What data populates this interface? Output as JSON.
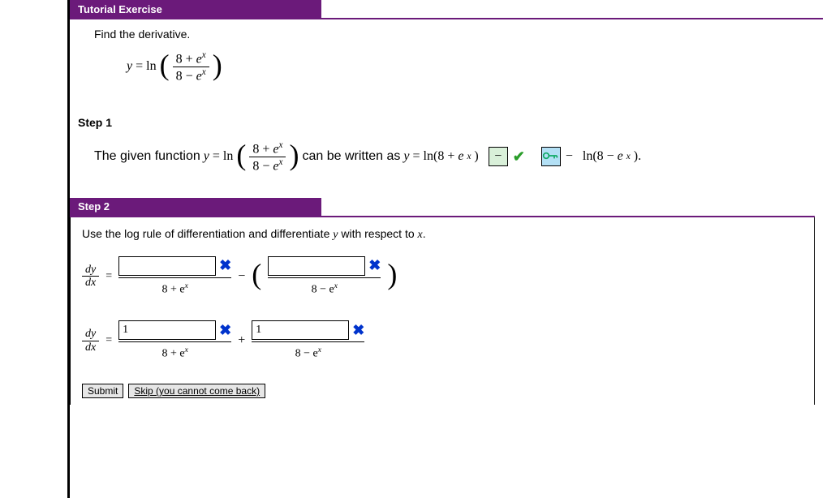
{
  "headers": {
    "tutorial": "Tutorial Exercise",
    "step2": "Step 2"
  },
  "prompt": "Find the derivative.",
  "eq1": {
    "lhs_y": "y",
    "eq": " = ",
    "ln": "ln",
    "num_a": "8 + ",
    "num_b": "e",
    "den_a": "8 − ",
    "den_b": "e"
  },
  "step1": {
    "label": "Step 1",
    "pre": "The given function ",
    "mid": " can be written as ",
    "after1": "ln(8 + ",
    "after2": ")",
    "tail": " ln(8 − ",
    "tail2": ")."
  },
  "step2": {
    "instr": "Use the log rule of differentiation and differentiate ",
    "instr2": " with respect to ",
    "instr3": ".",
    "dy": "dy",
    "dx": "dx",
    "den1": "8 + e",
    "den2": "8 − e",
    "plus": "+",
    "minus": "−",
    "val1": "1",
    "val2": "1"
  },
  "buttons": {
    "submit": "Submit",
    "skip": "Skip (you cannot come back)"
  }
}
